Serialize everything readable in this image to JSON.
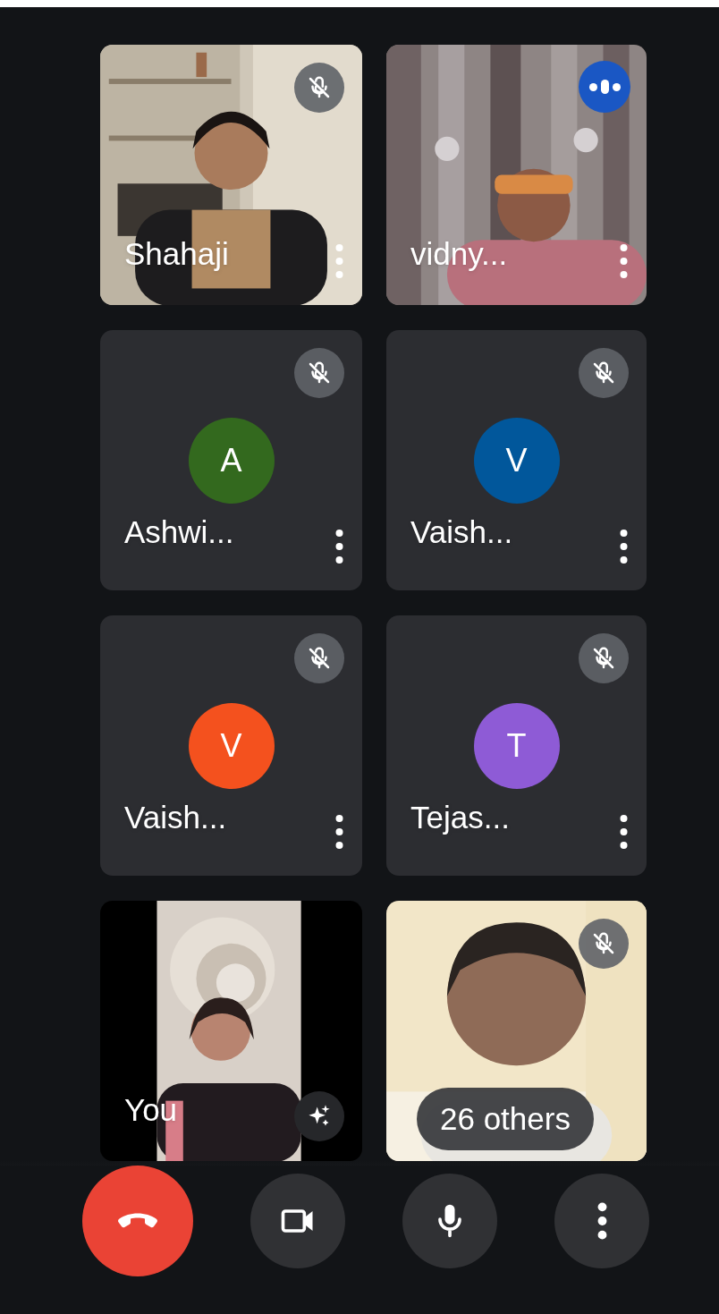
{
  "tiles": [
    {
      "kind": "video",
      "name": "Shahaji",
      "muted": true,
      "speaking": false,
      "menu": true
    },
    {
      "kind": "video",
      "name": "vidny...",
      "muted": false,
      "speaking": true,
      "menu": true
    },
    {
      "kind": "avatar",
      "name": "Ashwi...",
      "initial": "A",
      "color": "#33691e",
      "muted": true,
      "speaking": false,
      "menu": true
    },
    {
      "kind": "avatar",
      "name": "Vaish...",
      "initial": "V",
      "color": "#01579b",
      "muted": true,
      "speaking": false,
      "menu": true
    },
    {
      "kind": "avatar",
      "name": "Vaish...",
      "initial": "V",
      "color": "#f4511e",
      "muted": true,
      "speaking": false,
      "menu": true
    },
    {
      "kind": "avatar",
      "name": "Tejas...",
      "initial": "T",
      "color": "#8e5bd6",
      "muted": true,
      "speaking": false,
      "menu": true
    },
    {
      "kind": "self",
      "name": "You",
      "muted": false,
      "speaking": false,
      "menu": false,
      "effects": true
    },
    {
      "kind": "video",
      "muted": true,
      "speaking": false,
      "menu": false,
      "others": "26 others"
    }
  ],
  "controls": [
    {
      "kind": "hangup"
    },
    {
      "kind": "camera"
    },
    {
      "kind": "mic"
    },
    {
      "kind": "more"
    }
  ]
}
